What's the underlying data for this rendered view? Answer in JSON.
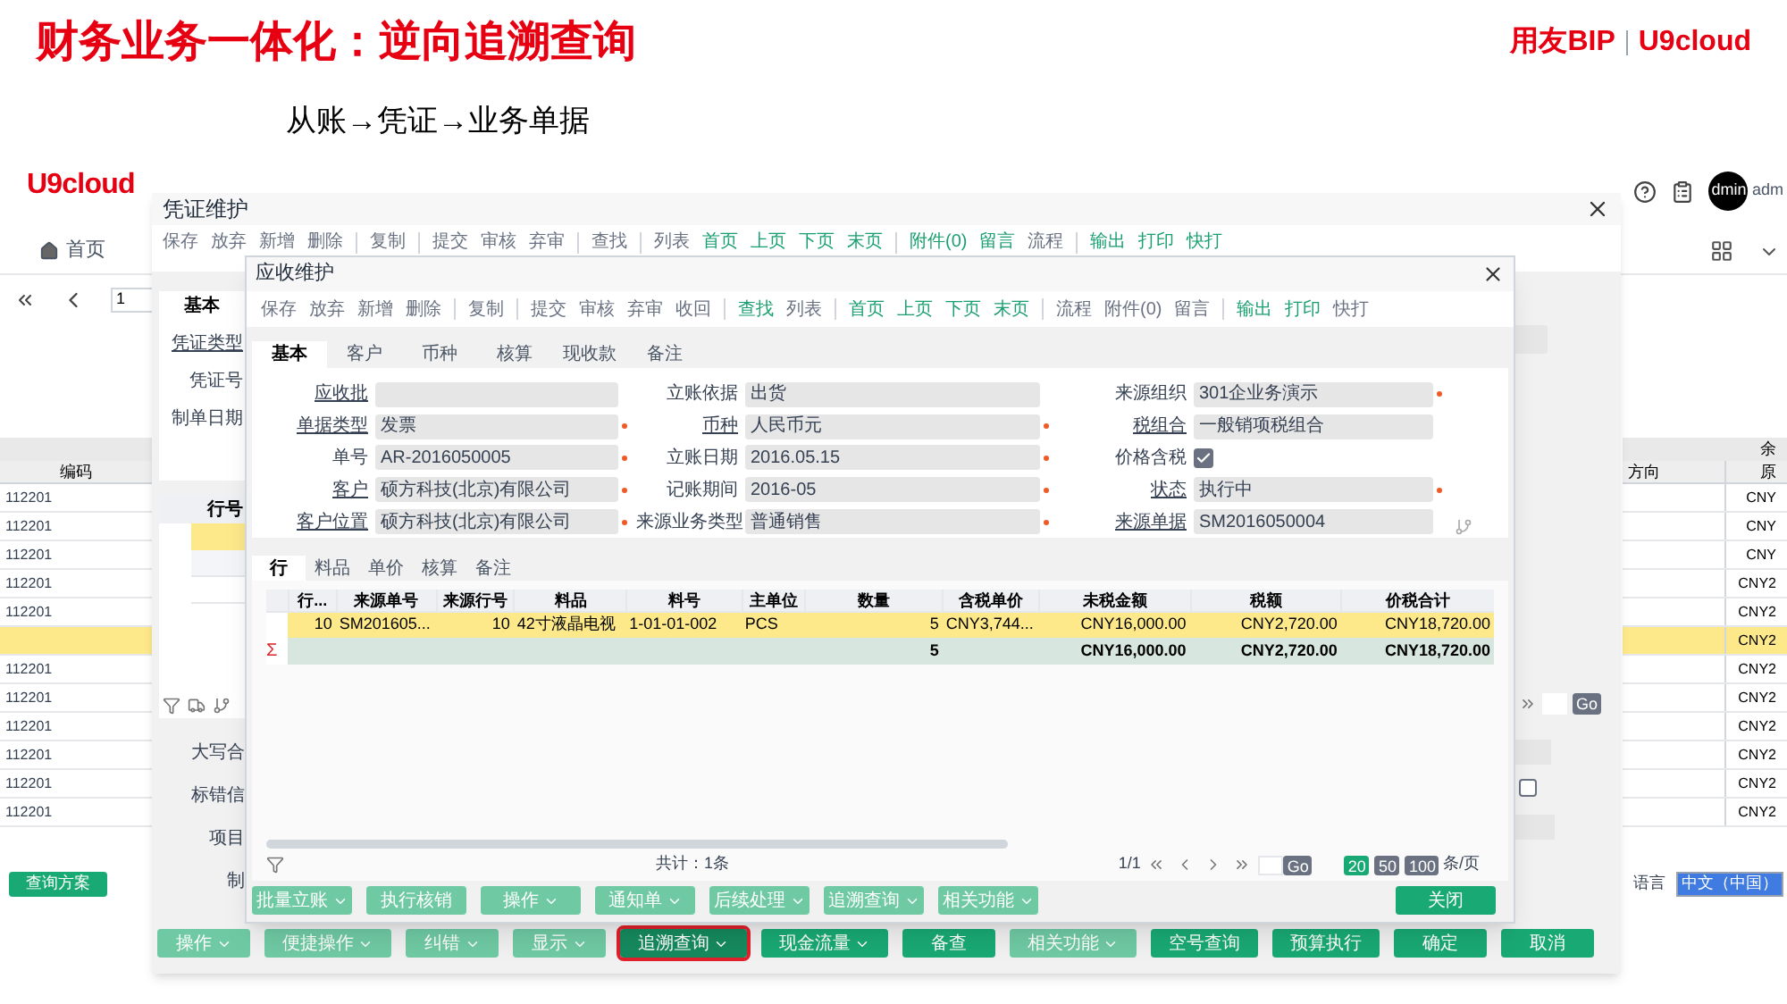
{
  "slide": {
    "title": "财务业务一体化：逆向追溯查询",
    "brand": "用友BIP",
    "product": "U9cloud",
    "subtitle": "从账→凭证→业务单据"
  },
  "app": {
    "logo": "U9cloud",
    "avatar": "dmin",
    "user": "adm",
    "home_tab": "首页",
    "page_input": "1",
    "table": {
      "left_header": "编码",
      "right_group": "余",
      "columns": [
        "方向",
        "原"
      ],
      "rows": [
        {
          "code": "112201",
          "value": "CNY",
          "selected": false
        },
        {
          "code": "112201",
          "value": "CNY",
          "selected": false
        },
        {
          "code": "112201",
          "value": "CNY",
          "selected": false
        },
        {
          "code": "112201",
          "value": "CNY2",
          "selected": false
        },
        {
          "code": "112201",
          "value": "CNY2",
          "selected": false
        },
        {
          "value": "CNY2",
          "selected": true
        },
        {
          "code": "112201",
          "value": "CNY2",
          "selected": false
        },
        {
          "code": "112201",
          "value": "CNY2",
          "selected": false
        },
        {
          "code": "112201",
          "value": "CNY2",
          "selected": false
        },
        {
          "code": "112201",
          "value": "CNY2",
          "selected": false
        },
        {
          "code": "112201",
          "value": "CNY2",
          "selected": false
        },
        {
          "code": "112201",
          "value": "CNY2",
          "selected": false
        }
      ]
    },
    "query_button": "查询方案",
    "language_label": "语言",
    "language": "中文（中国）"
  },
  "voucher": {
    "title": "凭证维护",
    "toolbar": [
      [
        {
          "label": "保存",
          "active": false
        },
        {
          "label": "放弃",
          "active": false
        },
        {
          "label": "新增",
          "active": false
        },
        {
          "label": "删除",
          "active": false
        }
      ],
      [
        {
          "label": "复制",
          "active": false
        }
      ],
      [
        {
          "label": "提交",
          "active": false
        },
        {
          "label": "审核",
          "active": false
        },
        {
          "label": "弃审",
          "active": false
        }
      ],
      [
        {
          "label": "查找",
          "active": false
        }
      ],
      [
        {
          "label": "列表",
          "active": false
        },
        {
          "label": "首页",
          "active": true
        },
        {
          "label": "上页",
          "active": true
        },
        {
          "label": "下页",
          "active": true
        },
        {
          "label": "末页",
          "active": true
        }
      ],
      [
        {
          "label": "附件(0)",
          "active": true
        },
        {
          "label": "留言",
          "active": true
        },
        {
          "label": "流程",
          "active": false
        }
      ],
      [
        {
          "label": "输出",
          "active": true
        },
        {
          "label": "打印",
          "active": true
        },
        {
          "label": "快打",
          "active": true
        }
      ]
    ],
    "tab": "基本",
    "fields": [
      {
        "label": "凭证类型",
        "link": true
      },
      {
        "label": "凭证号",
        "link": false
      },
      {
        "label": "制单日期",
        "link": false
      }
    ],
    "grid_header": "行号",
    "lower_labels": [
      "大写合",
      "标错信",
      "项目",
      "制"
    ],
    "go": "Go",
    "checkbox": {
      "checked": false
    },
    "buttons": [
      {
        "label": "操作",
        "dropdown": true,
        "disabled": true,
        "selected": false
      },
      {
        "label": "便捷操作",
        "dropdown": true,
        "disabled": true,
        "selected": false
      },
      {
        "label": "纠错",
        "dropdown": true,
        "disabled": true,
        "selected": false
      },
      {
        "label": "显示",
        "dropdown": true,
        "disabled": true,
        "selected": false
      },
      {
        "label": "追溯查询",
        "dropdown": true,
        "disabled": false,
        "selected": true
      },
      {
        "label": "现金流量",
        "dropdown": true,
        "disabled": false,
        "selected": false
      },
      {
        "label": "备查",
        "dropdown": false,
        "disabled": false,
        "selected": false
      },
      {
        "label": "相关功能",
        "dropdown": true,
        "disabled": true,
        "selected": false
      },
      {
        "label": "空号查询",
        "dropdown": false,
        "disabled": false,
        "selected": false
      },
      {
        "label": "预算执行",
        "dropdown": false,
        "disabled": false,
        "selected": false
      },
      {
        "label": "确定",
        "dropdown": false,
        "disabled": false,
        "selected": false
      },
      {
        "label": "取消",
        "dropdown": false,
        "disabled": false,
        "selected": false
      }
    ]
  },
  "receivable": {
    "title": "应收维护",
    "toolbar": [
      [
        {
          "label": "保存",
          "active": false
        },
        {
          "label": "放弃",
          "active": false
        },
        {
          "label": "新增",
          "active": false
        },
        {
          "label": "删除",
          "active": false
        }
      ],
      [
        {
          "label": "复制",
          "active": false
        }
      ],
      [
        {
          "label": "提交",
          "active": false
        },
        {
          "label": "审核",
          "active": false
        },
        {
          "label": "弃审",
          "active": false
        },
        {
          "label": "收回",
          "active": false
        }
      ],
      [
        {
          "label": "查找",
          "active": true
        },
        {
          "label": "列表",
          "active": false
        }
      ],
      [
        {
          "label": "首页",
          "active": true
        },
        {
          "label": "上页",
          "active": true
        },
        {
          "label": "下页",
          "active": true
        },
        {
          "label": "末页",
          "active": true
        }
      ],
      [
        {
          "label": "流程",
          "active": false
        },
        {
          "label": "附件(0)",
          "active": false
        },
        {
          "label": "留言",
          "active": false
        }
      ],
      [
        {
          "label": "输出",
          "active": true
        },
        {
          "label": "打印",
          "active": true
        },
        {
          "label": "快打",
          "active": false
        }
      ]
    ],
    "tabs": [
      {
        "label": "基本",
        "selected": true
      },
      {
        "label": "客户",
        "selected": false
      },
      {
        "label": "币种",
        "selected": false
      },
      {
        "label": "核算",
        "selected": false
      },
      {
        "label": "现收款",
        "selected": false
      },
      {
        "label": "备注",
        "selected": false
      }
    ],
    "form_columns": [
      [
        {
          "label": "应收批",
          "link": true,
          "kind": "text",
          "required": false
        },
        {
          "label": "单据类型",
          "link": true,
          "kind": "text",
          "value": "发票",
          "required": true
        },
        {
          "label": "单号",
          "link": false,
          "kind": "text",
          "value": "AR-2016050005",
          "required": true
        },
        {
          "label": "客户",
          "link": true,
          "kind": "text",
          "value": "硕方科技(北京)有限公司",
          "required": true
        },
        {
          "label": "客户位置",
          "link": true,
          "kind": "text",
          "value": "硕方科技(北京)有限公司",
          "required": true
        }
      ],
      [
        {
          "label": "立账依据",
          "link": false,
          "kind": "text",
          "value": "出货",
          "required": false
        },
        {
          "label": "币种",
          "link": true,
          "kind": "text",
          "value": "人民币元",
          "required": true
        },
        {
          "label": "立账日期",
          "link": false,
          "kind": "text",
          "value": "2016.05.15",
          "required": true
        },
        {
          "label": "记账期间",
          "link": false,
          "kind": "text",
          "value": "2016-05",
          "required": true
        },
        {
          "label": "来源业务类型",
          "link": false,
          "kind": "text",
          "value": "普通销售",
          "required": true
        }
      ],
      [
        {
          "label": "来源组织",
          "link": false,
          "kind": "text",
          "value": "301企业务演示",
          "required": true
        },
        {
          "label": "税组合",
          "link": true,
          "kind": "text",
          "value": "一般销项税组合",
          "required": false
        },
        {
          "label": "价格含税",
          "link": false,
          "kind": "checkbox",
          "checked": true,
          "required": false
        },
        {
          "label": "状态",
          "link": true,
          "kind": "text",
          "value": "执行中",
          "required": true
        },
        {
          "label": "来源单据",
          "link": true,
          "kind": "text",
          "value": "SM2016050004",
          "required": false
        }
      ]
    ],
    "grid_tabs": [
      {
        "label": "行",
        "selected": true
      },
      {
        "label": "料品",
        "selected": false
      },
      {
        "label": "单价",
        "selected": false
      },
      {
        "label": "核算",
        "selected": false
      },
      {
        "label": "备注",
        "selected": false
      }
    ],
    "grid": {
      "columns": [
        "行...",
        "来源单号",
        "来源行号",
        "料品",
        "料号",
        "主单位",
        "数量",
        "含税单价",
        "未税金额",
        "税额",
        "价税合计"
      ],
      "rows": [
        {
          "selected": true,
          "cells": [
            "10",
            "SM201605...",
            "10",
            "42寸液晶电视",
            "1-01-01-002",
            "PCS",
            "5",
            "CNY3,744...",
            "CNY16,000.00",
            "CNY2,720.00",
            "CNY18,720.00"
          ]
        }
      ],
      "sum_mark": "Σ",
      "sum_cells": [
        "",
        "",
        "",
        "",
        "",
        "",
        "5",
        "",
        "CNY16,000.00",
        "CNY2,720.00",
        "CNY18,720.00"
      ]
    },
    "total": "共计：1条",
    "page": "1/1",
    "go": "Go",
    "page_sizes": [
      {
        "label": "20",
        "selected": true
      },
      {
        "label": "50",
        "selected": false
      },
      {
        "label": "100",
        "selected": false
      }
    ],
    "page_unit": "条/页",
    "buttons": [
      {
        "label": "批量立账",
        "dropdown": true,
        "disabled": true
      },
      {
        "label": "执行核销",
        "dropdown": false,
        "disabled": true
      },
      {
        "label": "操作",
        "dropdown": true,
        "disabled": true
      },
      {
        "label": "通知单",
        "dropdown": true,
        "disabled": true
      },
      {
        "label": "后续处理",
        "dropdown": true,
        "disabled": true
      },
      {
        "label": "追溯查询",
        "dropdown": true,
        "disabled": true
      },
      {
        "label": "相关功能",
        "dropdown": true,
        "disabled": true
      }
    ],
    "close_button": "关闭"
  }
}
